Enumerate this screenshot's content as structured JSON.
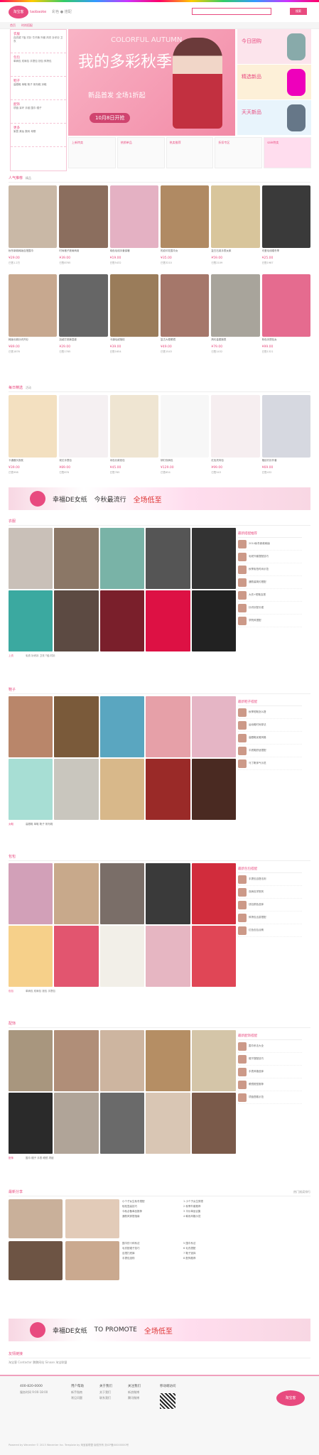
{
  "header": {
    "logo": "淘宝客",
    "logo_sub": "taobaoke",
    "slogan": "彩色 ● 搭配",
    "search_btn": "搜索"
  },
  "nav": [
    "首页",
    "时尚搭配"
  ],
  "categories": [
    {
      "title": "衣服",
      "words": "连衣裙 T恤 衬衫 牛仔裤 外套 风衣 针织衫 卫衣"
    },
    {
      "title": "包包",
      "words": "单肩包 双肩包 手提包 钱包 斜挎包"
    },
    {
      "title": "鞋子",
      "words": "高跟鞋 单鞋 靴子 帆布鞋 凉鞋"
    },
    {
      "title": "配饰",
      "words": "项链 耳环 手链 围巾 帽子"
    },
    {
      "title": "更多",
      "words": "家居 美妆 数码 母婴"
    }
  ],
  "banner": {
    "headline": "我的多彩秋季",
    "sub": "新品首发 全场1折起",
    "pill": "10月8日开抢",
    "eng": "COLORFUL AUTUMN"
  },
  "promos": [
    "今日团购",
    "精选新品",
    "天天新品"
  ],
  "thumbs": [
    "上新特卖",
    "热销单品",
    "热卖推荐",
    "折扣专区",
    "sale特卖"
  ],
  "sections": {
    "popular": "人气推荐",
    "popular_sub": "精品",
    "daily": "每日精选",
    "daily_sub": "活动"
  },
  "ad": {
    "brand": "幸福DE女纸",
    "txt": "今秋最流行",
    "big": "全场低至",
    "eng": "TO PROMOTE"
  },
  "cat_sections": [
    "衣服",
    "鞋子",
    "包包",
    "配饰"
  ],
  "side_title": "最新搭配推荐",
  "news_title": "最新分享",
  "news_right": "热门阅读排行",
  "links_title": "友情链接",
  "footer": {
    "cols": [
      "用户帮助",
      "关于我们",
      "关注我们",
      "移动端访问"
    ],
    "copy": "Powered by Wecenter © 2013 Wecenter Inc. Template by 淘宝客联盟 版权所有 浙ICP备00000000号"
  }
}
